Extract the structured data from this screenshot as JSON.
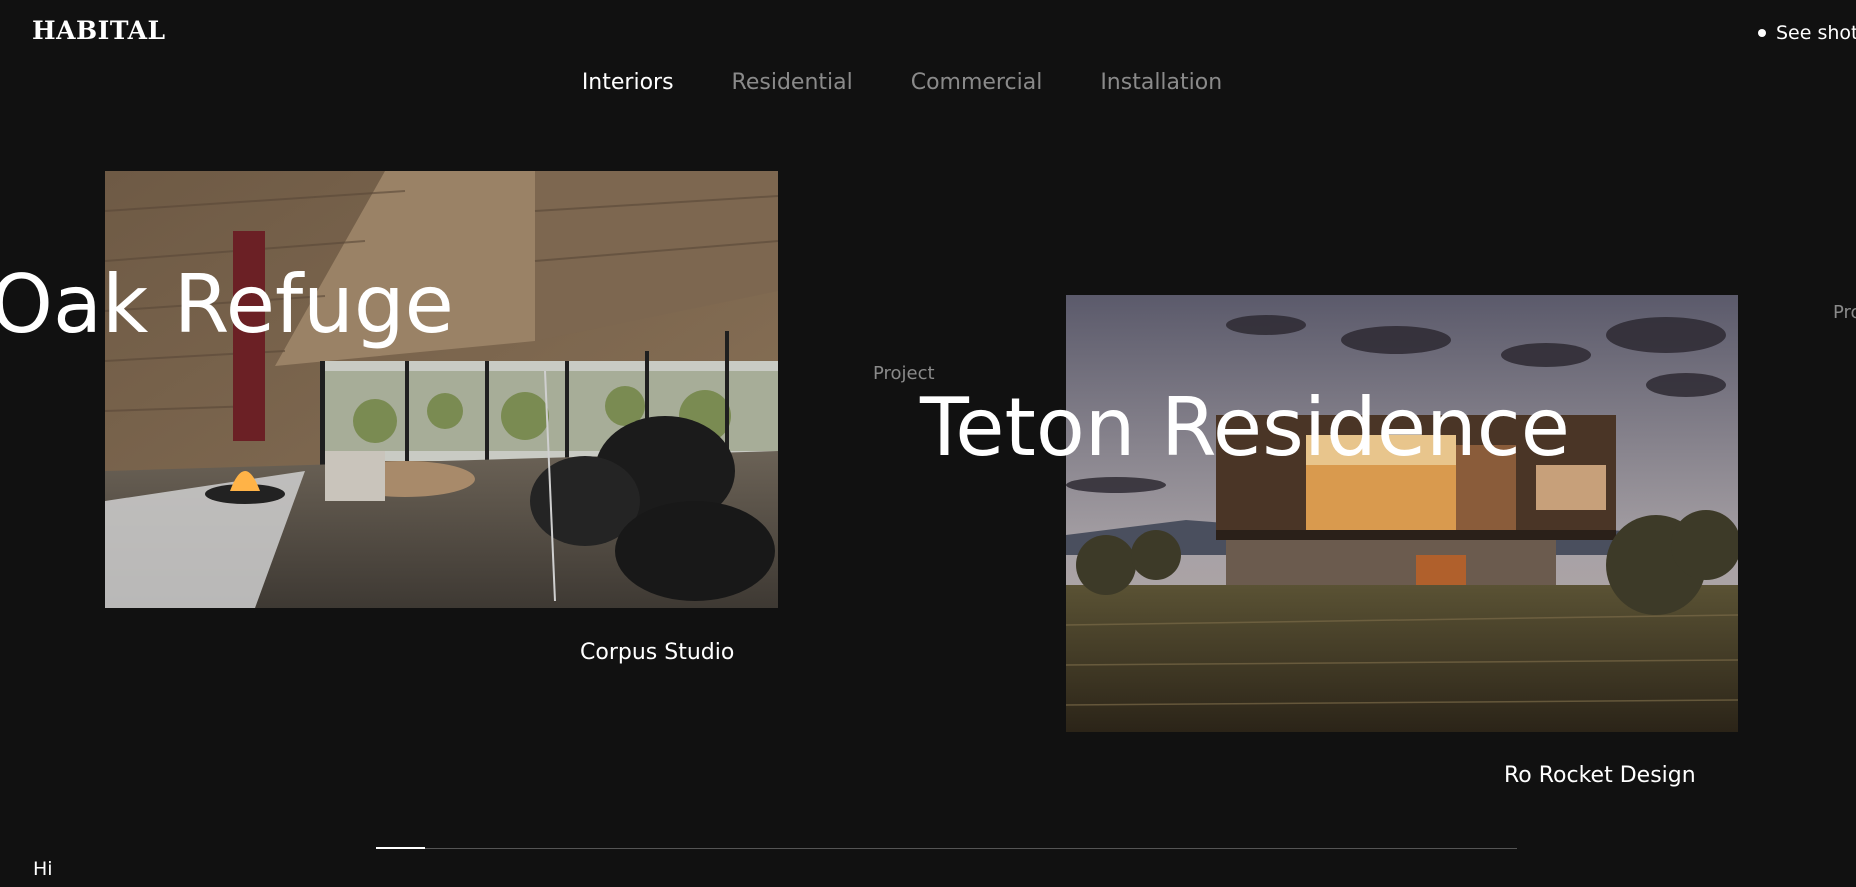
{
  "brand": {
    "logo": "HABITAL"
  },
  "header": {
    "see_button": "See shot"
  },
  "tabs": [
    {
      "label": "Interiors",
      "active": true
    },
    {
      "label": "Residential",
      "active": false
    },
    {
      "label": "Commercial",
      "active": false
    },
    {
      "label": "Installation",
      "active": false
    }
  ],
  "projects": [
    {
      "eyebrow": "",
      "title": "Oak Refuge",
      "studio": "Corpus Studio"
    },
    {
      "eyebrow": "Project",
      "title": "Teton Residence",
      "studio": "Ro Rocket Design"
    },
    {
      "eyebrow": "Pro"
    }
  ],
  "slider": {
    "progress_fraction": 0.043
  },
  "footer": {
    "greeting": "Hi"
  },
  "colors": {
    "background": "#111111",
    "text": "#ffffff",
    "muted": "#8a8a8a"
  }
}
